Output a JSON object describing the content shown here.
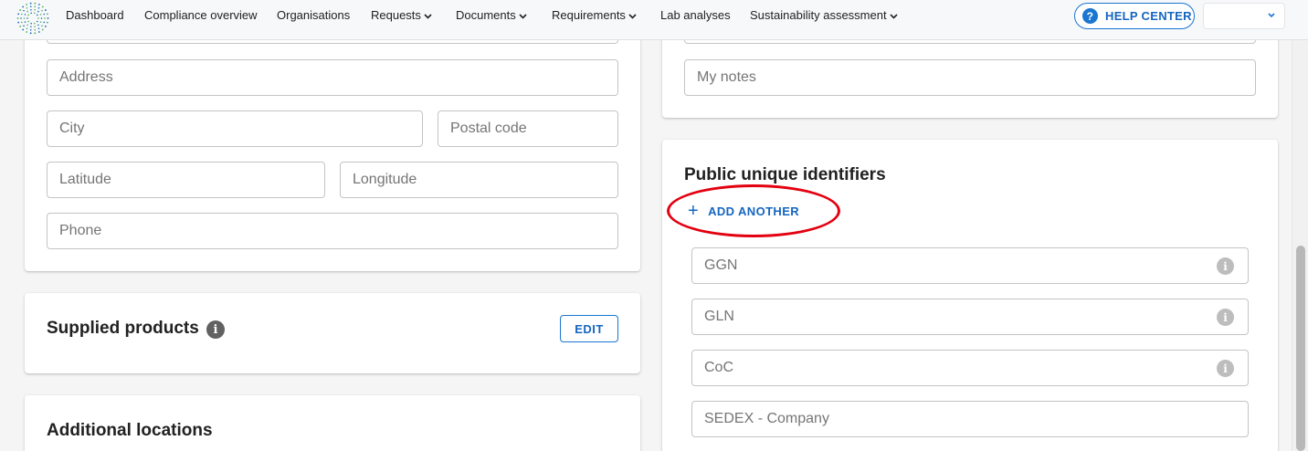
{
  "nav": {
    "items": [
      {
        "label": "Dashboard",
        "has_menu": false
      },
      {
        "label": "Compliance overview",
        "has_menu": false
      },
      {
        "label": "Organisations",
        "has_menu": false
      },
      {
        "label": "Requests",
        "has_menu": true
      },
      {
        "label": "Documents",
        "has_menu": true
      },
      {
        "label": "Requirements",
        "has_menu": true
      },
      {
        "label": "Lab analyses",
        "has_menu": false
      },
      {
        "label": "Sustainability assessment",
        "has_menu": true
      }
    ],
    "help_label": "HELP CENTER",
    "help_icon": "?",
    "language_value": ""
  },
  "address_form": {
    "address": "Address",
    "city": "City",
    "postal_code": "Postal code",
    "latitude": "Latitude",
    "longitude": "Longitude",
    "phone": "Phone"
  },
  "notes": {
    "my_notes": "My notes"
  },
  "supplied_products": {
    "title": "Supplied products",
    "info_icon": "i",
    "edit_label": "EDIT"
  },
  "additional_locations": {
    "title": "Additional locations"
  },
  "identifiers": {
    "title": "Public unique identifiers",
    "add_label": "ADD ANOTHER",
    "add_icon": "+",
    "info_icon": "i",
    "fields": [
      {
        "label": "GGN",
        "has_info": true
      },
      {
        "label": "GLN",
        "has_info": true
      },
      {
        "label": "CoC",
        "has_info": true
      },
      {
        "label": "SEDEX - Company",
        "has_info": false
      }
    ]
  },
  "colors": {
    "primary": "#1976d2",
    "annotation": "#e3000f",
    "logo_green": "#4caf50",
    "logo_blue": "#1565c0"
  }
}
